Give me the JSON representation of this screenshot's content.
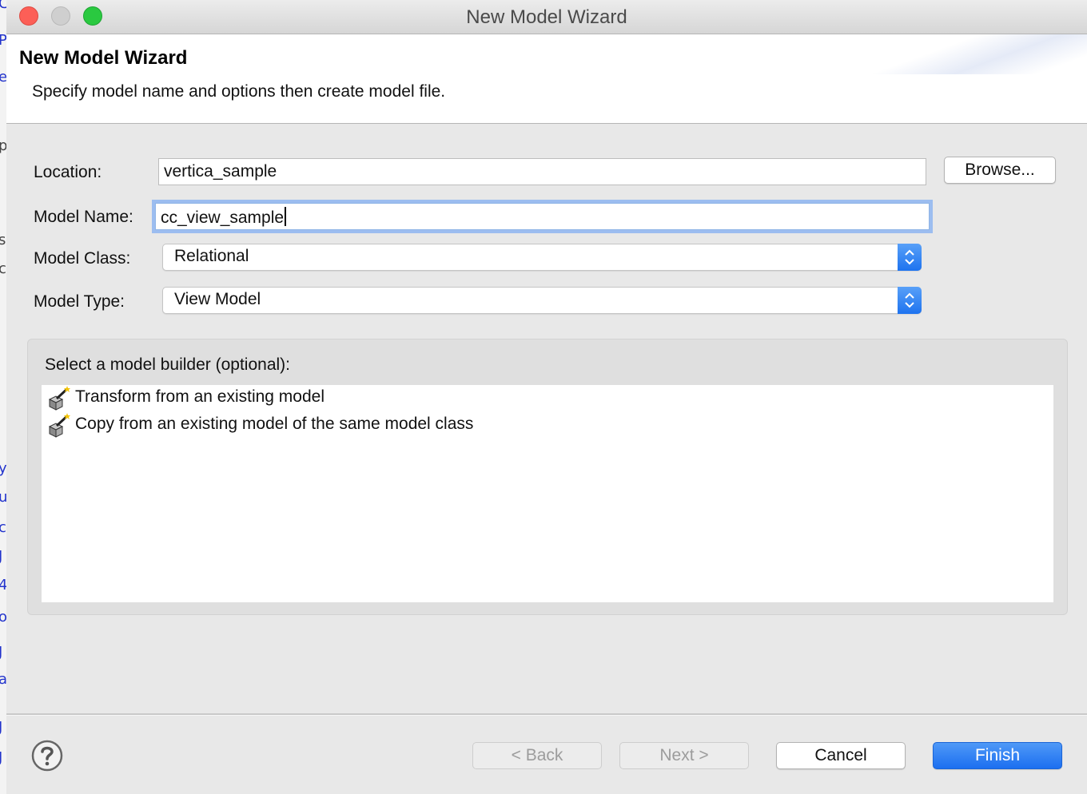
{
  "background_app": {
    "glyphs": [
      "C",
      "P",
      "e",
      "p",
      "s",
      "c",
      "y",
      "u",
      "c",
      "J",
      "4",
      "o",
      "J",
      "a",
      "J",
      "J"
    ]
  },
  "window": {
    "title": "New Model Wizard"
  },
  "banner": {
    "title": "New Model Wizard",
    "description": "Specify model name and options then create model file."
  },
  "form": {
    "location": {
      "label": "Location:",
      "value": "vertica_sample",
      "browse_label": "Browse..."
    },
    "model_name": {
      "label": "Model Name:",
      "value": "cc_view_sample"
    },
    "model_class": {
      "label": "Model Class:",
      "selected": "Relational"
    },
    "model_type": {
      "label": "Model Type:",
      "selected": "View Model"
    }
  },
  "builder": {
    "label": "Select a model builder (optional):",
    "items": [
      {
        "label": "Transform from an existing model",
        "icon": "model-builder-icon"
      },
      {
        "label": "Copy from an existing model of the same model class",
        "icon": "model-builder-icon"
      }
    ]
  },
  "footer": {
    "help_icon": "help-icon",
    "back_label": "< Back",
    "next_label": "Next >",
    "cancel_label": "Cancel",
    "finish_label": "Finish"
  },
  "colors": {
    "accent": "#1c6ff0",
    "focus_ring": "#9cbdf0",
    "dialog_bg": "#e8e8e8",
    "close_light": "#fc5f57",
    "max_light": "#2ac940"
  }
}
